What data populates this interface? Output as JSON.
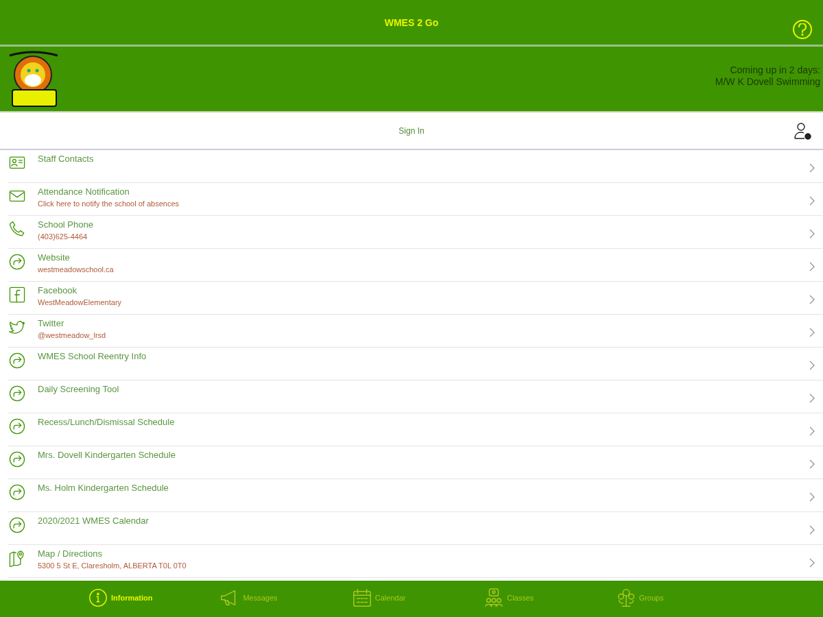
{
  "top_bar": {
    "title": "WMES 2 Go"
  },
  "banner": {
    "upcoming_label": "Coming up in 2 days:",
    "upcoming_event": "M/W K Dovell Swimming"
  },
  "sign_in": {
    "label": "Sign In"
  },
  "items": [
    {
      "kind": "contact",
      "title": "Staff Contacts"
    },
    {
      "kind": "mail",
      "title": "Attendance Notification",
      "subtitle": "Click here to notify the school of absences"
    },
    {
      "kind": "phone",
      "title": "School Phone",
      "subtitle": "(403)625-4464"
    },
    {
      "kind": "link",
      "title": "Website",
      "subtitle": "westmeadowschool.ca"
    },
    {
      "kind": "facebook",
      "title": "Facebook",
      "subtitle": "WestMeadowElementary"
    },
    {
      "kind": "twitter",
      "title": "Twitter",
      "subtitle": "@westmeadow_lrsd"
    },
    {
      "kind": "link",
      "title": "WMES School Reentry Info"
    },
    {
      "kind": "link",
      "title": "Daily Screening Tool"
    },
    {
      "kind": "link",
      "title": "Recess/Lunch/Dismissal Schedule"
    },
    {
      "kind": "link",
      "title": "Mrs. Dovell Kindergarten Schedule"
    },
    {
      "kind": "link",
      "title": "Ms. Holm Kindergarten Schedule"
    },
    {
      "kind": "link",
      "title": "2020/2021 WMES Calendar"
    },
    {
      "kind": "map",
      "title": "Map / Directions",
      "subtitle": "5300 5 St E, Claresholm, ALBERTA T0L 0T0"
    }
  ],
  "tabs": [
    {
      "kind": "info",
      "label": "Information",
      "selected": true
    },
    {
      "kind": "megaphone",
      "label": "Messages",
      "selected": false
    },
    {
      "kind": "calendar",
      "label": "Calendar",
      "selected": false
    },
    {
      "kind": "classes",
      "label": "Classes",
      "selected": false
    },
    {
      "kind": "groups",
      "label": "Groups",
      "selected": false
    }
  ]
}
